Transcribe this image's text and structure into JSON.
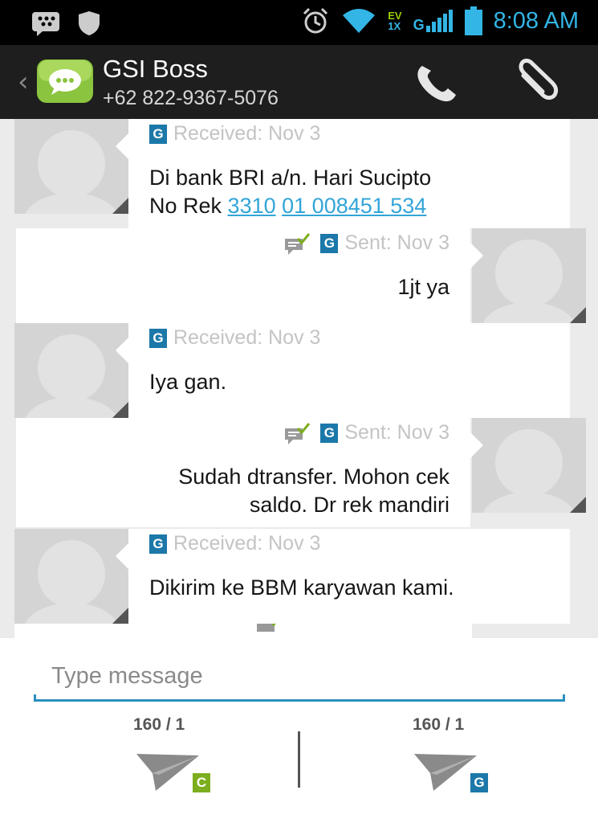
{
  "status_bar": {
    "time": "8:08 AM",
    "network_top": "EV",
    "network_bottom": "1X",
    "signal_label": "G"
  },
  "header": {
    "contact_name": "GSI Boss",
    "contact_phone": "+62 822-9367-5076"
  },
  "messages": [
    {
      "direction": "received",
      "channel": "G",
      "meta": "Received: Nov 3",
      "line1": "Di bank BRI a/n. Hari Sucipto",
      "line2_prefix": "No Rek ",
      "link1": "3310",
      "link2": "01 008451 534"
    },
    {
      "direction": "sent",
      "channel": "G",
      "meta": "Sent: Nov 3",
      "text": "1jt ya"
    },
    {
      "direction": "received",
      "channel": "G",
      "meta": "Received: Nov 3",
      "text": "Iya gan."
    },
    {
      "direction": "sent",
      "channel": "G",
      "meta": "Sent: Nov 3",
      "line1": "Sudah dtransfer. Mohon cek",
      "line2": "saldo. Dr rek mandiri"
    },
    {
      "direction": "received",
      "channel": "G",
      "meta": "Received: Nov 3",
      "text": "Dikirim ke BBM karyawan kami."
    }
  ],
  "compose": {
    "placeholder": "Type message",
    "counters": [
      "160 / 1",
      "160 / 1"
    ],
    "send_badges": [
      "C",
      "G"
    ]
  },
  "colors": {
    "accent": "#33b5e5",
    "badge_blue": "#1c78a9",
    "badge_green": "#7dae1e",
    "link": "#33a5d8"
  },
  "icons": [
    "blackberry-icon",
    "shield-icon",
    "alarm-icon",
    "wifi-icon",
    "signal-icon",
    "battery-icon",
    "chevron-left-icon",
    "chat-bubble-icon",
    "phone-icon",
    "paperclip-icon",
    "person-icon",
    "delivered-check-icon",
    "send-icon"
  ]
}
